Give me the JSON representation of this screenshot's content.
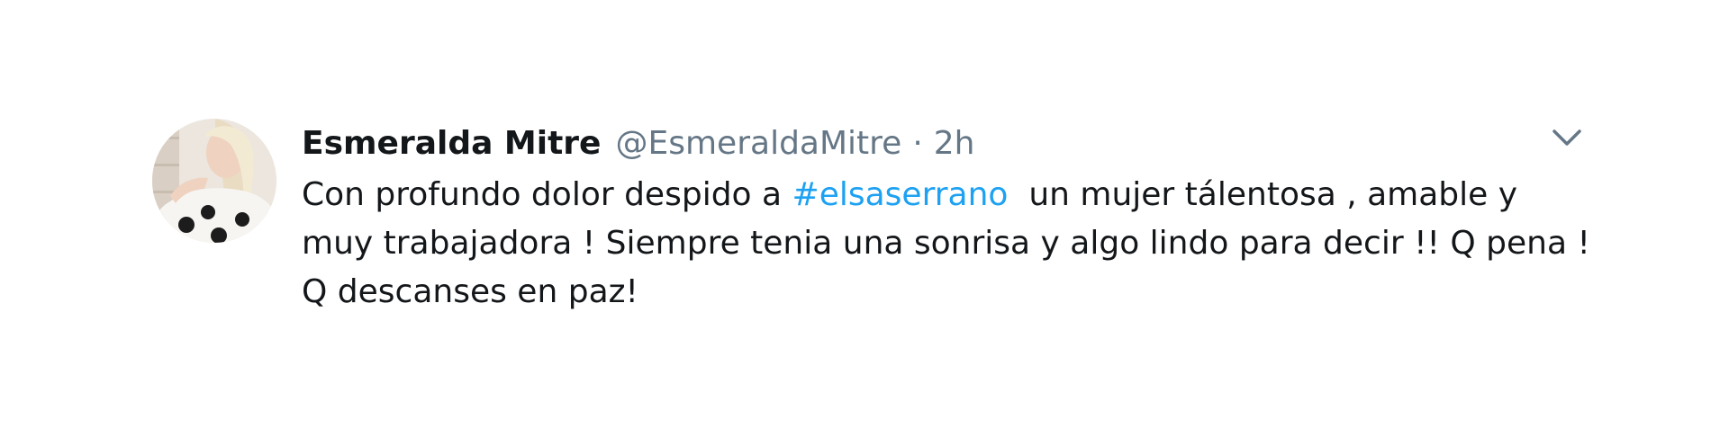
{
  "tweet": {
    "author_name": "Esmeralda Mitre",
    "author_handle": "@EsmeraldaMitre",
    "separator": "·",
    "timestamp": "2h",
    "text_before": "Con profundo dolor despido a ",
    "hashtag": "#elsaserrano",
    "text_after": "  un mujer tálentosa , amable y muy trabajadora ! Siempre tenia una sonrisa y algo lindo para decir !! Q pena ! Q descanses en paz!",
    "hashtag_color": "#1da1f2",
    "more_icon": "chevron-down-icon"
  }
}
